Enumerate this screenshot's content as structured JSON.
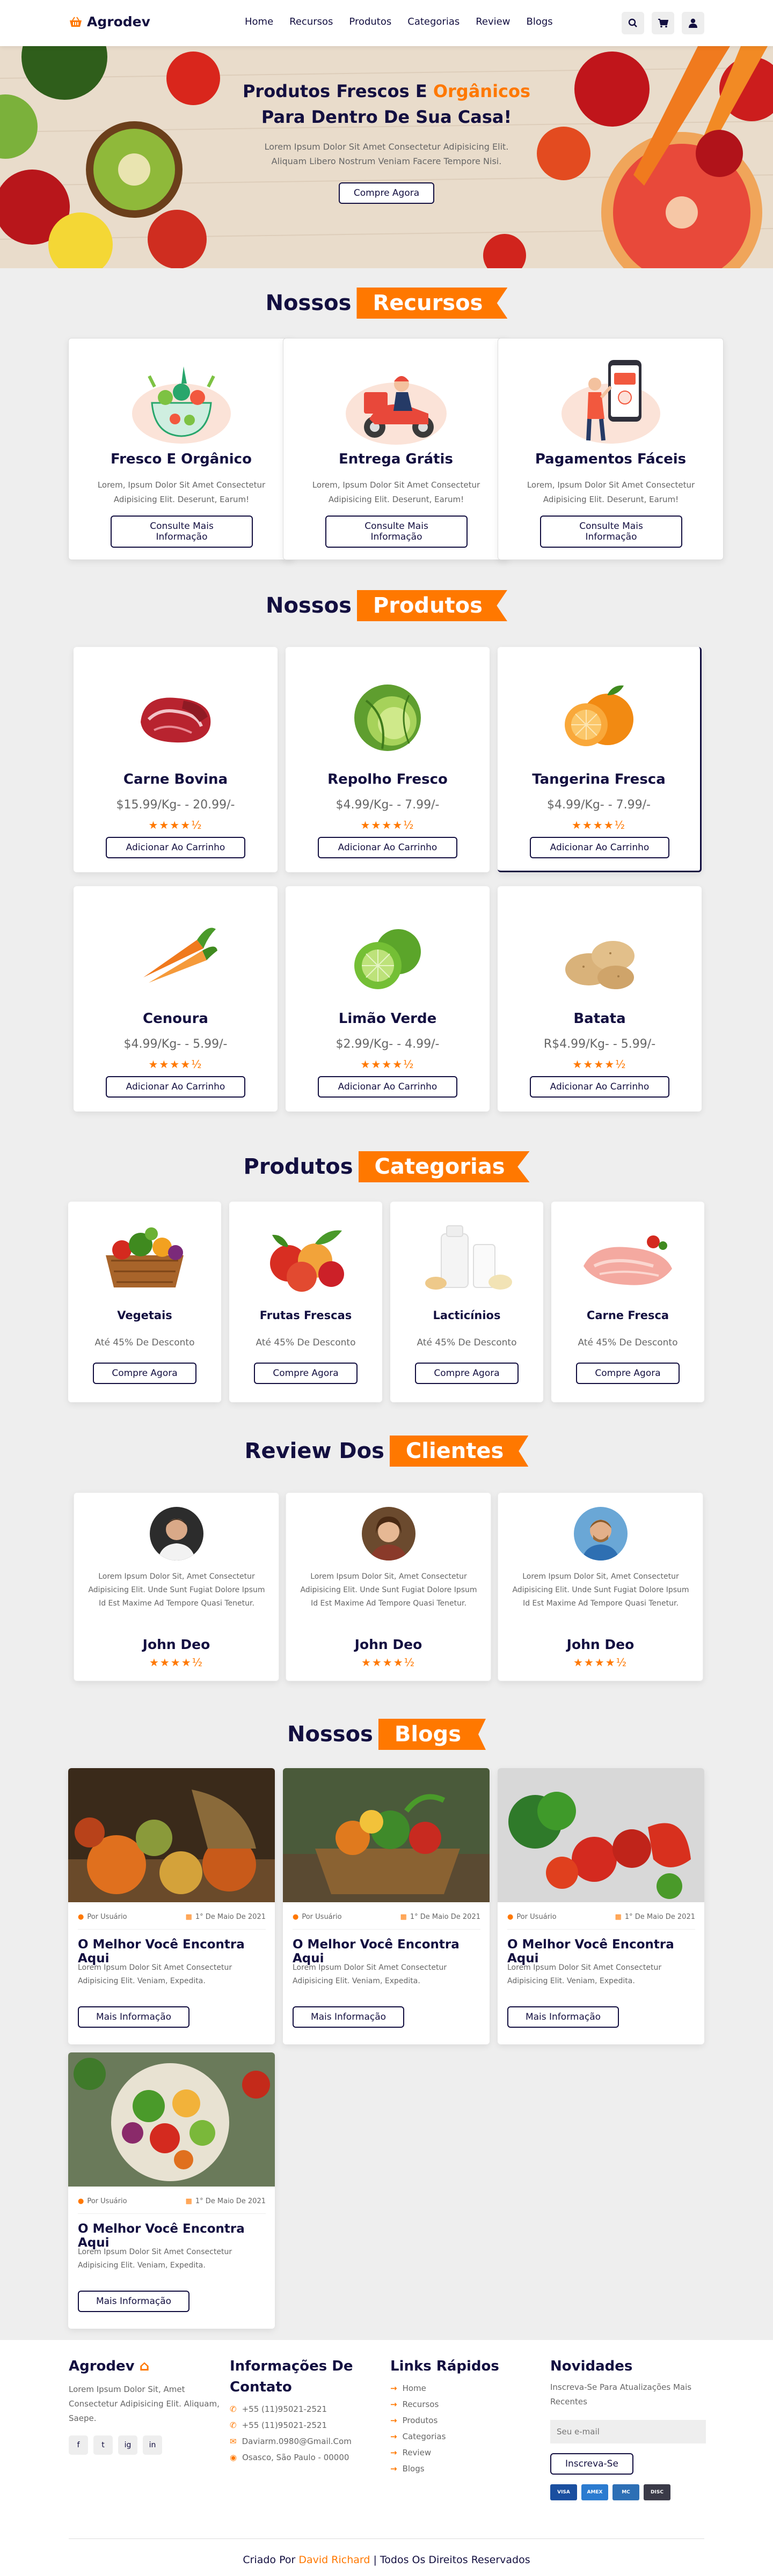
{
  "header": {
    "logo": "Agrodev",
    "nav": [
      "Home",
      "Recursos",
      "Produtos",
      "Categorias",
      "Review",
      "Blogs"
    ],
    "icons": [
      "search-icon",
      "cart-icon",
      "user-icon"
    ]
  },
  "hero": {
    "title_part1": "Produtos Frescos E",
    "title_accent": "Orgânicos",
    "title_part2": "Para Dentro De Sua Casa!",
    "text": "Lorem Ipsum Dolor Sit Amet Consectetur Adipisicing Elit. Aliquam Libero Nostrum Veniam Facere Tempore Nisi.",
    "button": "Compre Agora"
  },
  "features": {
    "heading": "Nossos",
    "heading_accent": "Recursos",
    "items": [
      {
        "title": "Fresco E Orgânico",
        "text": "Lorem, Ipsum Dolor Sit Amet Consectetur Adipisicing Elit. Deserunt, Earum!",
        "button": "Consulte Mais Informação"
      },
      {
        "title": "Entrega Grátis",
        "text": "Lorem, Ipsum Dolor Sit Amet Consectetur Adipisicing Elit. Deserunt, Earum!",
        "button": "Consulte Mais Informação"
      },
      {
        "title": "Pagamentos Fáceis",
        "text": "Lorem, Ipsum Dolor Sit Amet Consectetur Adipisicing Elit. Deserunt, Earum!",
        "button": "Consulte Mais Informação"
      }
    ]
  },
  "products": {
    "heading": "Nossos",
    "heading_accent": "Produtos",
    "rating": "★★★★½",
    "items": [
      {
        "name": "Carne Bovina",
        "price": "$15.99/Kg- - 20.99/-",
        "button": "Adicionar Ao Carrinho"
      },
      {
        "name": "Repolho Fresco",
        "price": "$4.99/Kg- - 7.99/-",
        "button": "Adicionar Ao Carrinho"
      },
      {
        "name": "Tangerina Fresca",
        "price": "$4.99/Kg- - 7.99/-",
        "button": "Adicionar Ao Carrinho"
      },
      {
        "name": "Cenoura",
        "price": "$4.99/Kg- - 5.99/-",
        "button": "Adicionar Ao Carrinho"
      },
      {
        "name": "Limão Verde",
        "price": "$2.99/Kg- - 4.99/-",
        "button": "Adicionar Ao Carrinho"
      },
      {
        "name": "Batata",
        "price": "R$4.99/Kg- - 5.99/-",
        "button": "Adicionar Ao Carrinho"
      }
    ]
  },
  "categories": {
    "heading": "Produtos",
    "heading_accent": "Categorias",
    "items": [
      {
        "name": "Vegetais",
        "discount": "Até 45% De Desconto",
        "button": "Compre Agora"
      },
      {
        "name": "Frutas Frescas",
        "discount": "Até 45% De Desconto",
        "button": "Compre Agora"
      },
      {
        "name": "Lacticínios",
        "discount": "Até 45% De Desconto",
        "button": "Compre Agora"
      },
      {
        "name": "Carne Fresca",
        "discount": "Até 45% De Desconto",
        "button": "Compre Agora"
      }
    ]
  },
  "reviews": {
    "heading": "Review Dos",
    "heading_accent": "Clientes",
    "rating": "★★★★½",
    "items": [
      {
        "text": "Lorem Ipsum Dolor Sit, Amet Consectetur Adipisicing Elit. Unde Sunt Fugiat Dolore Ipsum Id Est Maxime Ad Tempore Quasi Tenetur.",
        "name": "John Deo"
      },
      {
        "text": "Lorem Ipsum Dolor Sit, Amet Consectetur Adipisicing Elit. Unde Sunt Fugiat Dolore Ipsum Id Est Maxime Ad Tempore Quasi Tenetur.",
        "name": "John Deo"
      },
      {
        "text": "Lorem Ipsum Dolor Sit, Amet Consectetur Adipisicing Elit. Unde Sunt Fugiat Dolore Ipsum Id Est Maxime Ad Tempore Quasi Tenetur.",
        "name": "John Deo"
      }
    ]
  },
  "blogs": {
    "heading": "Nossos",
    "heading_accent": "Blogs",
    "items": [
      {
        "author": "Por Usuário",
        "date": "1° De Maio De 2021",
        "title": "O Melhor Você Encontra Aqui",
        "text": "Lorem Ipsum Dolor Sit Amet Consectetur Adipisicing Elit. Veniam, Expedita.",
        "button": "Mais Informação"
      },
      {
        "author": "Por Usuário",
        "date": "1° De Maio De 2021",
        "title": "O Melhor Você Encontra Aqui",
        "text": "Lorem Ipsum Dolor Sit Amet Consectetur Adipisicing Elit. Veniam, Expedita.",
        "button": "Mais Informação"
      },
      {
        "author": "Por Usuário",
        "date": "1° De Maio De 2021",
        "title": "O Melhor Você Encontra Aqui",
        "text": "Lorem Ipsum Dolor Sit Amet Consectetur Adipisicing Elit. Veniam, Expedita.",
        "button": "Mais Informação"
      },
      {
        "author": "Por Usuário",
        "date": "1° De Maio De 2021",
        "title": "O Melhor Você Encontra Aqui",
        "text": "Lorem Ipsum Dolor Sit Amet Consectetur Adipisicing Elit. Veniam, Expedita.",
        "button": "Mais Informação"
      }
    ]
  },
  "footer": {
    "brand": "Agrodev",
    "brand_text": "Lorem Ipsum Dolor Sit, Amet Consectetur Adipisicing Elit. Aliquam, Saepe.",
    "social": [
      "f",
      "t",
      "ig",
      "in"
    ],
    "contact_title": "Informações De Contato",
    "contact": [
      "+55 (11)95021-2521",
      "+55 (11)95021-2521",
      "Daviarm.0980@Gmail.Com",
      "Osasco, São Paulo - 00000"
    ],
    "links_title": "Links Rápidos",
    "links": [
      "Home",
      "Recursos",
      "Produtos",
      "Categorias",
      "Review",
      "Blogs"
    ],
    "news_title": "Novidades",
    "news_text": "Inscreva-Se Para Atualizações Mais Recentes",
    "email_placeholder": "Seu e-mail",
    "subscribe": "Inscreva-Se",
    "payments": [
      "VISA",
      "AMEX",
      "MC",
      "DISC"
    ],
    "credit_prefix": "Criado Por",
    "credit_name": "David Richard",
    "credit_suffix": "| Todos Os Direitos Reservados"
  },
  "colors": {
    "accent": "#ff7800",
    "dark": "#130f40",
    "background": "#eeeeee"
  }
}
